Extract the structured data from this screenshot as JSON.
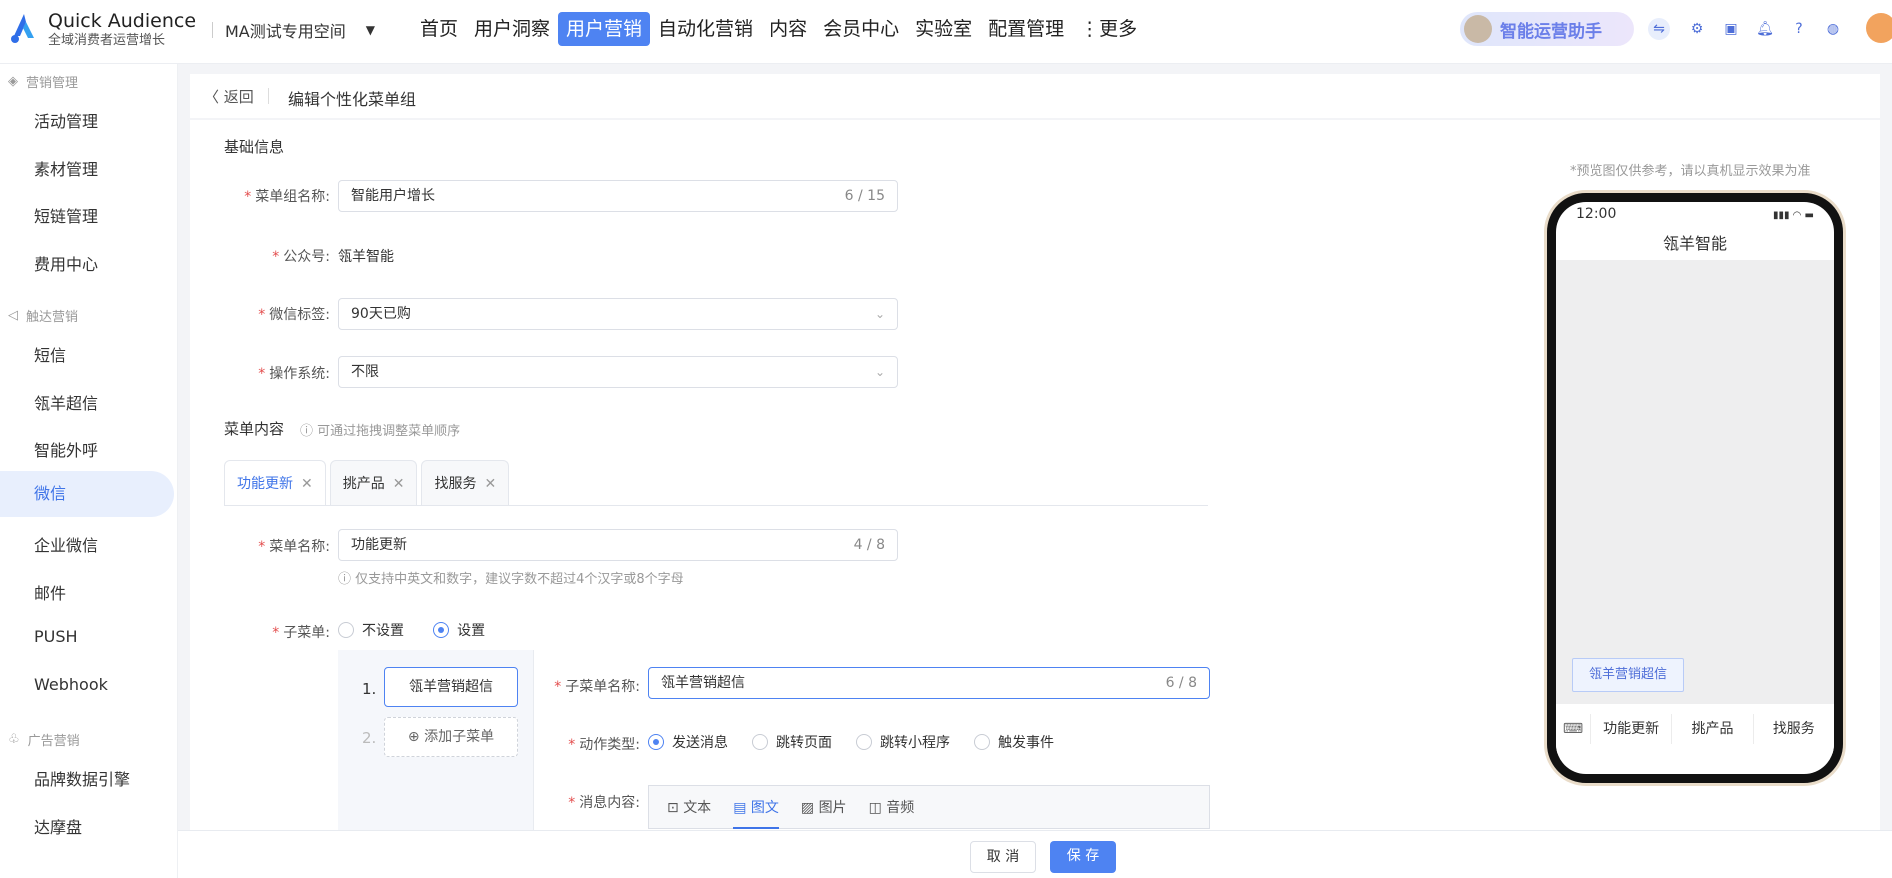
{
  "brand": {
    "name": "Quick Audience",
    "tagline": "全域消费者运营增长"
  },
  "workspace": {
    "name": "MA测试专用空间"
  },
  "nav": {
    "items": [
      {
        "label": "首页",
        "active": false
      },
      {
        "label": "用户洞察",
        "active": false
      },
      {
        "label": "用户营销",
        "active": true
      },
      {
        "label": "自动化营销",
        "active": false
      },
      {
        "label": "内容",
        "active": false
      },
      {
        "label": "会员中心",
        "active": false
      },
      {
        "label": "实验室",
        "active": false
      },
      {
        "label": "配置管理",
        "active": false
      },
      {
        "label": "⋮更多",
        "active": false
      }
    ]
  },
  "assistant": {
    "label": "智能运营助手"
  },
  "sidebar": {
    "groups": [
      {
        "title": "营销管理",
        "items": [
          "活动管理",
          "素材管理",
          "短链管理",
          "费用中心"
        ]
      },
      {
        "title": "触达营销",
        "items": [
          "短信",
          "瓴羊超信",
          "智能外呼",
          "微信",
          "企业微信",
          "邮件",
          "PUSH",
          "Webhook"
        ]
      },
      {
        "title": "广告营销",
        "items": [
          "品牌数据引擎",
          "达摩盘"
        ]
      }
    ],
    "active": "微信"
  },
  "header": {
    "back_label": "返回",
    "title": "编辑个性化菜单组"
  },
  "basic": {
    "section_title": "基础信息",
    "group_name_label": "菜单组名称:",
    "group_name_value": "智能用户增长",
    "group_name_count": "6 / 15",
    "account_label": "公众号:",
    "account_value": "瓴羊智能",
    "tag_label": "微信标签:",
    "tag_value": "90天已购",
    "os_label": "操作系统:",
    "os_value": "不限"
  },
  "menu": {
    "section_title": "菜单内容",
    "section_hint": "ⓘ 可通过拖拽调整菜单顺序",
    "tabs": [
      {
        "label": "功能更新",
        "active": true
      },
      {
        "label": "挑产品",
        "active": false
      },
      {
        "label": "找服务",
        "active": false
      }
    ],
    "name_label": "菜单名称:",
    "name_value": "功能更新",
    "name_count": "4 / 8",
    "name_hint": "ⓘ 仅支持中英文和数字，建议字数不超过4个汉字或8个字母",
    "submenu_label": "子菜单:",
    "submenu_opt_off": "不设置",
    "submenu_opt_on": "设置",
    "sub_items": [
      {
        "index": "1.",
        "label": "瓴羊营销超信"
      },
      {
        "index": "2.",
        "label": "添加子菜单"
      }
    ],
    "sub_name_label": "子菜单名称:",
    "sub_name_value": "瓴羊营销超信",
    "sub_name_count": "6 / 8",
    "action_label": "动作类型:",
    "actions": [
      "发送消息",
      "跳转页面",
      "跳转小程序",
      "触发事件"
    ],
    "msg_label": "消息内容:",
    "msg_tabs": [
      {
        "label": "文本",
        "active": false
      },
      {
        "label": "图文",
        "active": true
      },
      {
        "label": "图片",
        "active": false
      },
      {
        "label": "音频",
        "active": false
      }
    ]
  },
  "footer": {
    "cancel": "取 消",
    "save": "保 存"
  },
  "preview": {
    "caption": "*预览图仅供参考，请以真机显示效果为准",
    "time": "12:00",
    "account": "瓴羊智能",
    "bubble": "瓴羊营销超信",
    "menus": [
      "功能更新",
      "挑产品",
      "找服务"
    ]
  },
  "colors": {
    "accent": "#4e83f2",
    "required": "#e34d4d"
  }
}
